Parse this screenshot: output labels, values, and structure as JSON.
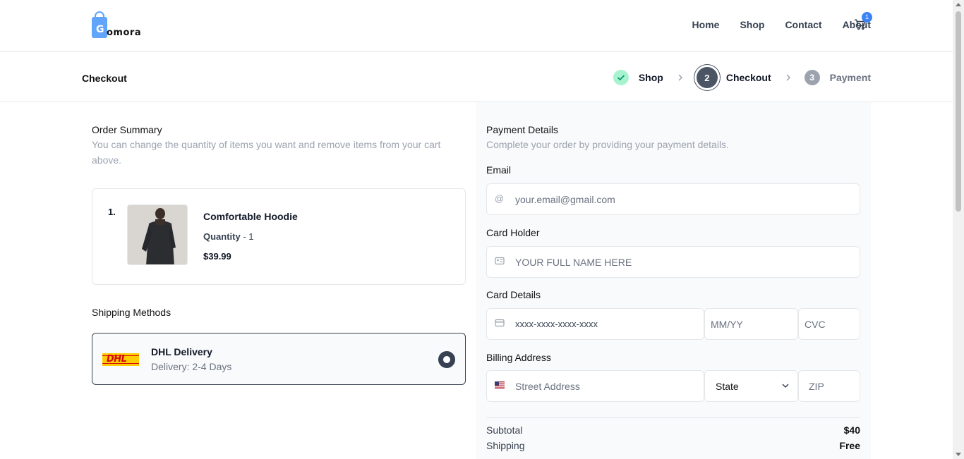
{
  "brand": {
    "logo_text": "omora",
    "logo_letter": "G"
  },
  "nav": {
    "links": [
      "Home",
      "Shop",
      "Contact",
      "About"
    ],
    "cart_count": "1"
  },
  "checkout": {
    "title": "Checkout",
    "steps": [
      {
        "label": "Shop",
        "state": "done"
      },
      {
        "number": "2",
        "label": "Checkout",
        "state": "active"
      },
      {
        "number": "3",
        "label": "Payment",
        "state": "pending"
      }
    ]
  },
  "order_summary": {
    "title": "Order Summary",
    "subtitle": "You can change the quantity of items you want and remove items from your cart above.",
    "items": [
      {
        "index": "1.",
        "name": "Comfortable Hoodie",
        "quantity_label": "Quantity",
        "quantity_value": " - 1",
        "price": "$39.99"
      }
    ]
  },
  "shipping": {
    "title": "Shipping Methods",
    "methods": [
      {
        "logo": "DHL",
        "name": "DHL Delivery",
        "description": "Delivery: 2-4 Days",
        "selected": true
      }
    ]
  },
  "payment": {
    "title": "Payment Details",
    "subtitle": "Complete your order by providing your payment details.",
    "email_label": "Email",
    "email_placeholder": "your.email@gmail.com",
    "holder_label": "Card Holder",
    "holder_placeholder": "YOUR FULL NAME HERE",
    "card_label": "Card Details",
    "card_number_placeholder": "xxxx-xxxx-xxxx-xxxx",
    "expiry_placeholder": "MM/YY",
    "cvc_placeholder": "CVC",
    "billing_label": "Billing Address",
    "street_placeholder": "Street Address",
    "state_value": "State",
    "zip_placeholder": "ZIP"
  },
  "totals": {
    "subtotal_label": "Subtotal",
    "subtotal_value": "$40",
    "shipping_label": "Shipping",
    "shipping_value": "Free"
  },
  "colors": {
    "accent": "#3b82f6",
    "step_done": "#a7f3d0",
    "step_active": "#4b5563",
    "dhl_yellow": "#ffcc00",
    "dhl_red": "#d40511"
  }
}
